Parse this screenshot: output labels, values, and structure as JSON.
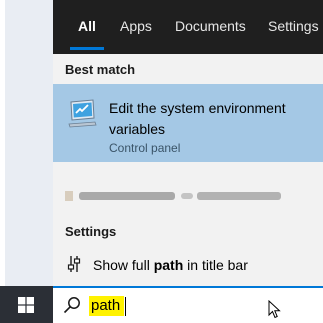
{
  "tabs": [
    {
      "label": "All",
      "active": true
    },
    {
      "label": "Apps"
    },
    {
      "label": "Documents"
    },
    {
      "label": "Settings"
    }
  ],
  "best_match": {
    "heading": "Best match",
    "title": "Edit the system environment variables",
    "subtitle": "Control panel",
    "icon": "system-properties-icon"
  },
  "settings": {
    "heading": "Settings",
    "item_prefix": "Show full ",
    "item_bold": "path",
    "item_suffix": " in title bar",
    "icon": "toggle-icon"
  },
  "search": {
    "value": "path",
    "icon": "search-icon"
  },
  "colors": {
    "accent": "#0078d7",
    "selection": "#a4c8e5",
    "tabbar": "#1f1f1f",
    "highlight": "#fff200"
  }
}
